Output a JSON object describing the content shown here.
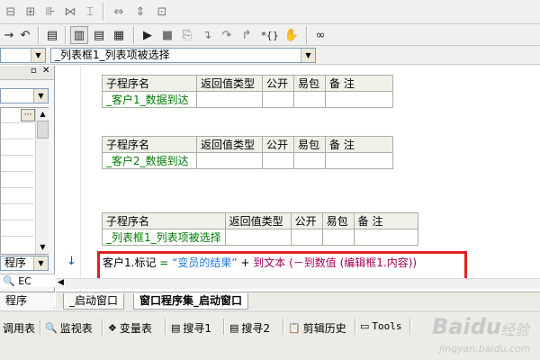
{
  "toolbar": {
    "row1_icons": [
      "align-left-icon",
      "align-center-icon",
      "align-spacing-icon",
      "align-horizontal-icon",
      "align-vertical-icon",
      "width-icon",
      "height-icon",
      "size-icon"
    ],
    "row2_icons": [
      "back-icon",
      "undo-icon",
      "find-icon",
      "layout-1-icon",
      "layout-2-icon",
      "layout-3-icon",
      "run-icon",
      "stop-icon",
      "step-icon",
      "step-into-icon",
      "step-over-icon",
      "step-out-icon",
      "watch-icon",
      "hand-icon",
      "binoculars-icon"
    ]
  },
  "event_combo": {
    "value": "_列表框1_列表项被选择"
  },
  "left_panel": {
    "tab_ec": "EC",
    "combo_bottom": "程序",
    "tab_label": "程序"
  },
  "tables": [
    {
      "headers": [
        "子程序名",
        "返回值类型",
        "公开",
        "易包",
        "备 注"
      ],
      "name": "_客户1_数据到达"
    },
    {
      "headers": [
        "子程序名",
        "返回值类型",
        "公开",
        "易包",
        "备 注"
      ],
      "name": "_客户2_数据到达"
    },
    {
      "headers": [
        "子程序名",
        "返回值类型",
        "公开",
        "易包",
        "备 注"
      ],
      "name": "_列表框1_列表项被选择"
    }
  ],
  "code": {
    "part1": "客户1.标记 ",
    "part2": "= ",
    "part3": "“变员的结果”",
    "part4": " + ",
    "part5": "到文本 (－到数值 (编辑框1.内容))",
    "highlight_color": "#e02020"
  },
  "tabs": [
    {
      "label": "_启动窗口"
    },
    {
      "label": "窗口程序集_启动窗口"
    }
  ],
  "bottom_bar": [
    {
      "icon": "call-table-icon",
      "label": "调用表"
    },
    {
      "icon": "search-icon",
      "label": "监视表"
    },
    {
      "icon": "variable-icon",
      "label": "变量表"
    },
    {
      "icon": "find1-icon",
      "label": "搜寻1"
    },
    {
      "icon": "find2-icon",
      "label": "搜寻2"
    },
    {
      "icon": "clipboard-icon",
      "label": "剪辑历史"
    },
    {
      "icon": "tools-icon",
      "label": "Tools"
    }
  ],
  "watermark": {
    "brand": "Baidu",
    "sub": "经验",
    "url": "jingyan.baidu.com"
  }
}
